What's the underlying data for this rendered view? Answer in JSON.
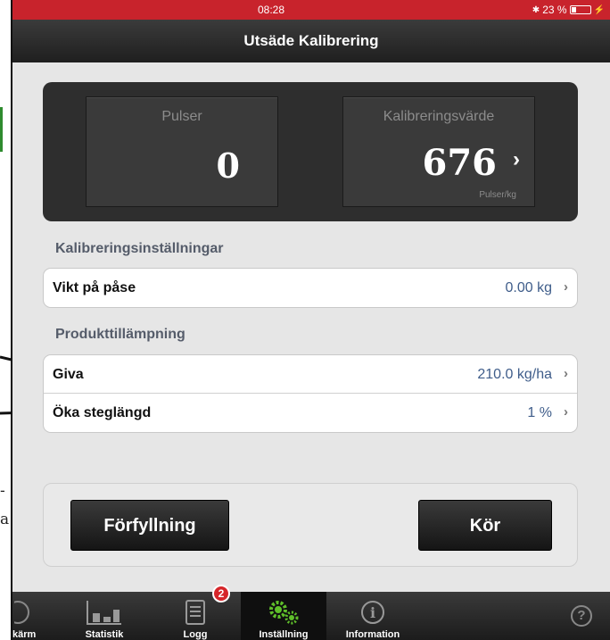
{
  "status": {
    "time": "08:28",
    "bluetooth": "✱",
    "battery": "23 %",
    "battery_level": 0.23,
    "charging": "⚡"
  },
  "nav": {
    "title": "Utsäde Kalibrering"
  },
  "tiles": {
    "pulser": {
      "label": "Pulser",
      "value": "0"
    },
    "kalib": {
      "label": "Kalibreringsvärde",
      "value": "676",
      "unit": "Pulser/kg",
      "chevron": "›"
    }
  },
  "sections": {
    "kalibrering": {
      "title": "Kalibreringsinställningar",
      "rows": [
        {
          "label": "Vikt på påse",
          "value": "0.00 kg"
        }
      ]
    },
    "produkt": {
      "title": "Produkttillämpning",
      "rows": [
        {
          "label": "Giva",
          "value": "210.0 kg/ha"
        },
        {
          "label": "Öka steglängd",
          "value": "1 %"
        }
      ]
    }
  },
  "row_chevron": "›",
  "buttons": {
    "forfyllning": "Förfyllning",
    "kor": "Kör"
  },
  "tabs": [
    {
      "label": "kärm",
      "icon": "gauge-icon"
    },
    {
      "label": "Statistik",
      "icon": "bar-chart-icon"
    },
    {
      "label": "Logg",
      "icon": "log-icon",
      "badge": "2"
    },
    {
      "label": "Inställning",
      "icon": "gears-icon"
    },
    {
      "label": "Information",
      "icon": "info-icon"
    }
  ],
  "help": {
    "icon": "help-icon",
    "glyph": "?"
  },
  "doc_fragments": [
    "-",
    "a"
  ],
  "colors": {
    "status": "#c8232c",
    "accent_value": "#3f5d8a",
    "gear": "#5fbf2a",
    "badge": "#d6262a"
  }
}
